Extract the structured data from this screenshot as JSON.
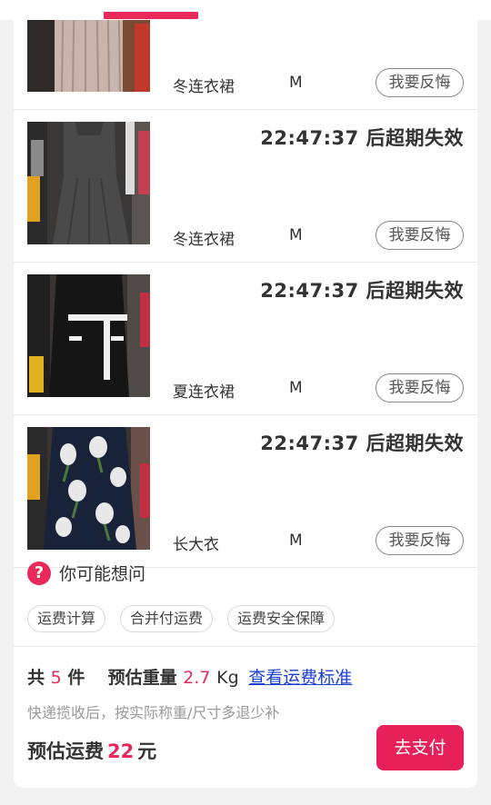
{
  "header": {
    "active_tab_color": "#e8295a"
  },
  "items": [
    {
      "expire": "",
      "name": "冬连衣裙",
      "size": "M",
      "action": "我要反悔"
    },
    {
      "expire": "22:47:37 后超期失效",
      "name": "冬连衣裙",
      "size": "M",
      "action": "我要反悔"
    },
    {
      "expire": "22:47:37 后超期失效",
      "name": "夏连衣裙",
      "size": "M",
      "action": "我要反悔"
    },
    {
      "expire": "22:47:37 后超期失效",
      "name": "长大衣",
      "size": "M",
      "action": "我要反悔"
    }
  ],
  "faq": {
    "icon": "question-circle-icon",
    "title": "你可能想问",
    "chips": [
      "运费计算",
      "合并付运费",
      "运费安全保障"
    ]
  },
  "summary": {
    "total_prefix": "共",
    "count": "5",
    "count_unit": "件",
    "weight_label": "预估重量",
    "weight": "2.7",
    "weight_unit": "Kg",
    "link": "查看运费标准",
    "note": "快递揽收后，按实际称重/尺寸多退少补",
    "fee_label": "预估运费",
    "fee": "22",
    "fee_unit": "元",
    "pay_label": "去支付"
  },
  "colors": {
    "accent": "#e8295a",
    "link": "#1a3fd6"
  }
}
